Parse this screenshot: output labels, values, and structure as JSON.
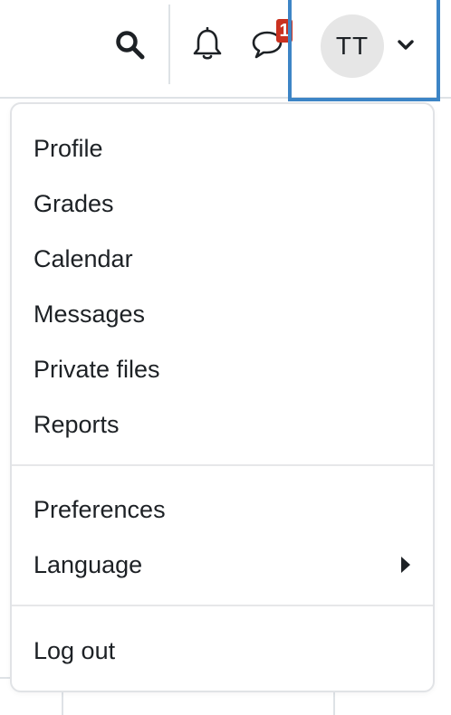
{
  "navbar": {
    "icons": {
      "search": "search-icon",
      "notifications": "bell-icon",
      "messages": "chat-bubble-icon",
      "user_caret": "chevron-down-icon"
    },
    "messages_badge": "1",
    "avatar_initials": "TT"
  },
  "user_menu": {
    "group1": [
      "Profile",
      "Grades",
      "Calendar",
      "Messages",
      "Private files",
      "Reports"
    ],
    "group2": [
      "Preferences",
      "Language"
    ],
    "group3": [
      "Log out"
    ]
  },
  "colors": {
    "focus_outline": "#3d85c6",
    "badge": "#ca3120",
    "link": "#0f6cbf"
  }
}
